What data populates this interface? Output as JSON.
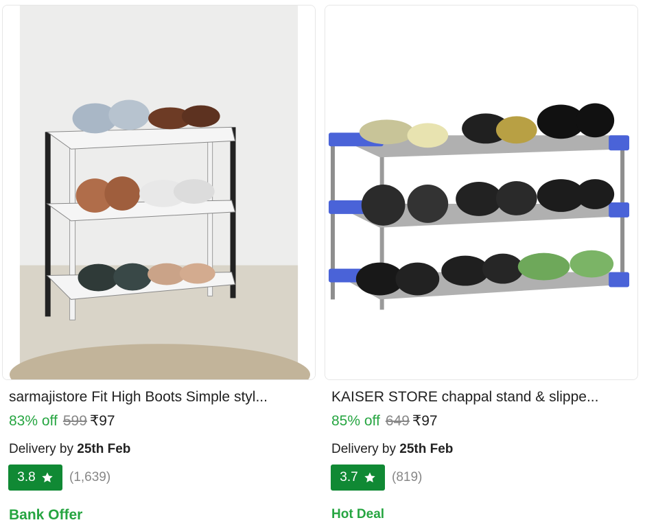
{
  "products": [
    {
      "image_alt": "three-tier shoe rack with shoes on white wall",
      "title": "sarmajistore Fit High Boots Simple styl...",
      "discount": "83% off",
      "mrp": "599",
      "price": "₹97",
      "delivery_label": "Delivery by",
      "delivery_date": "25th Feb",
      "rating": "3.8",
      "rating_count": "(1,639)",
      "offer": "Bank Offer"
    },
    {
      "image_alt": "blue and steel three-tier shoe rack with sandals",
      "title": "KAISER STORE chappal stand & slippe...",
      "discount": "85% off",
      "mrp": "649",
      "price": "₹97",
      "delivery_label": "Delivery by",
      "delivery_date": "25th Feb",
      "rating": "3.7",
      "rating_count": "(819)",
      "offer": "Hot Deal"
    }
  ],
  "colors": {
    "discount_green": "#26a541",
    "rating_badge": "#108934",
    "muted": "#878787",
    "text": "#212121"
  },
  "icons": {
    "rating": "star-icon"
  }
}
